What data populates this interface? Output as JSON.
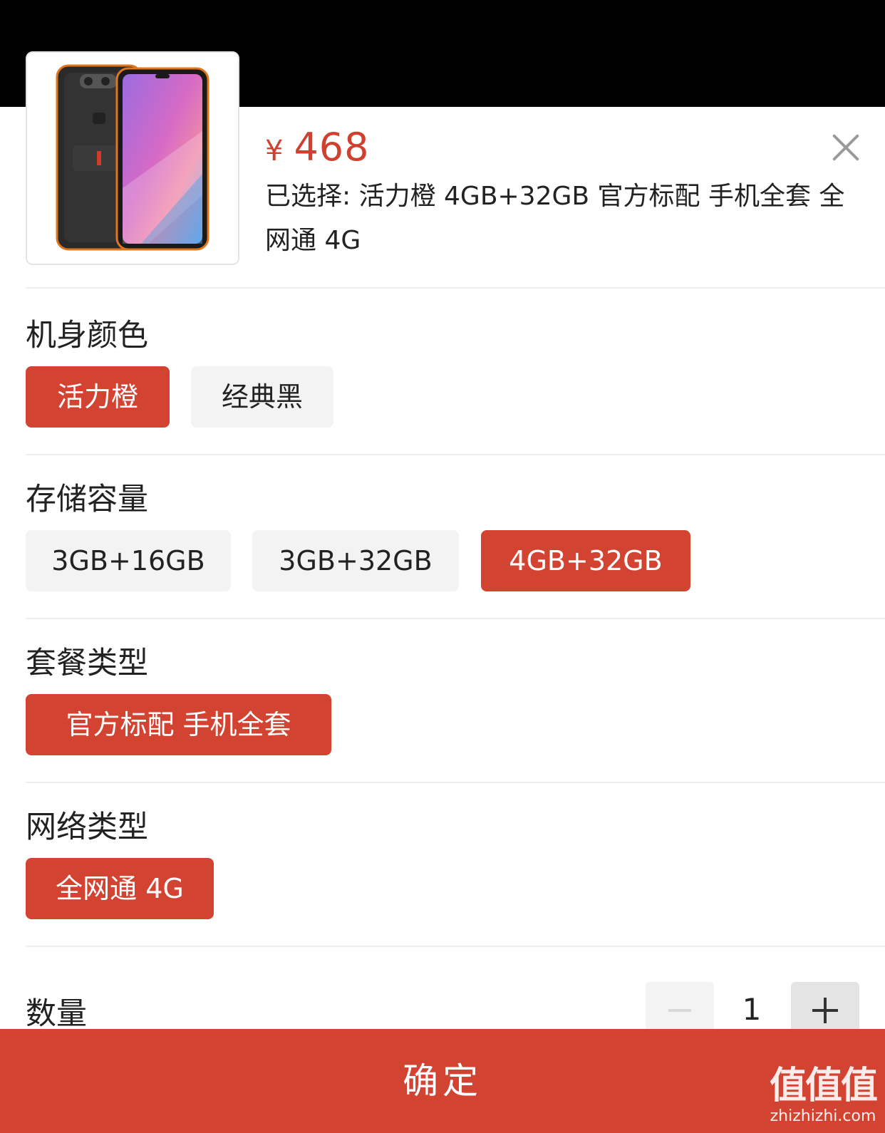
{
  "product": {
    "price_symbol": "¥",
    "price": "468",
    "selected_text": "已选择: 活力橙 4GB+32GB 官方标配 手机全套 全网通 4G"
  },
  "groups": [
    {
      "title": "机身颜色",
      "options": [
        "活力橙",
        "经典黑"
      ],
      "selected": "活力橙"
    },
    {
      "title": "存储容量",
      "options": [
        "3GB+16GB",
        "3GB+32GB",
        "4GB+32GB"
      ],
      "selected": "4GB+32GB"
    },
    {
      "title": "套餐类型",
      "options": [
        "官方标配 手机全套"
      ],
      "selected": "官方标配 手机全套"
    },
    {
      "title": "网络类型",
      "options": [
        "全网通 4G"
      ],
      "selected": "全网通 4G"
    }
  ],
  "quantity": {
    "label": "数量",
    "value": "1"
  },
  "confirm_label": "确定",
  "watermark": {
    "logo": "值值值",
    "url": "zhizhizhi.com"
  },
  "colors": {
    "accent": "#d34332",
    "price": "#d0402f",
    "chip_bg": "#f3f3f3"
  },
  "icons": {
    "close": "close-icon",
    "minus": "minus-icon",
    "plus": "plus-icon"
  }
}
